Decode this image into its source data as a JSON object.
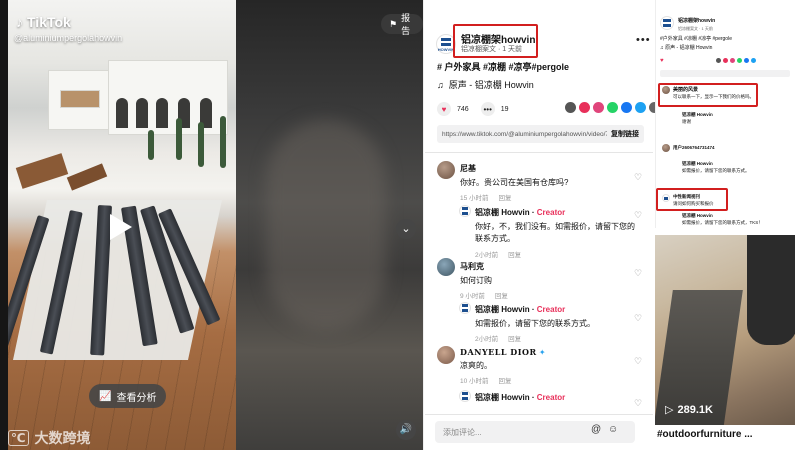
{
  "video": {
    "app_name": "TikTok",
    "handle": "@aluminiumpergolahowvin",
    "report_label": "报告",
    "analysis_label": "查看分析",
    "watermark": "大数跨境"
  },
  "post": {
    "author_name": "铝凉棚架howvin",
    "author_subtitle": "铝凉棚案文 · 1 天前",
    "hashtags": "# 户外家具 #凉棚 #凉亭#pergole",
    "sound": "原声 - 铝凉棚 Howvin",
    "likes": "746",
    "comments": "19",
    "url": "https://www.tiktok.com/@aluminiumpergolahowvin/video/71...",
    "copy_link": "复制链接"
  },
  "comments": [
    {
      "name": "尼基",
      "text": "你好。贵公司在美国有仓库吗?",
      "time": "15 小时前",
      "reply": "回复"
    },
    {
      "name": "铝凉棚 Howvin · ",
      "creator": "Creator",
      "text": "你好，不，我们没有。如需报价，请留下您的联系方式。",
      "time": "2小时前",
      "reply": "回复"
    },
    {
      "name": "马利克",
      "text": "如何订购",
      "time": "9 小时前",
      "reply": "回复"
    },
    {
      "name": "铝凉棚 Howvin · ",
      "creator": "Creator",
      "text": "如需报价，请留下您的联系方式。",
      "time": "2小时前",
      "reply": "回复"
    },
    {
      "name": "DANYELL DIOR",
      "text": "凉爽的。",
      "time": "10 小时前",
      "reply": "回复"
    },
    {
      "name": "铝凉棚 Howvin · ",
      "creator": "Creator",
      "text": "",
      "time": "",
      "reply": ""
    }
  ],
  "add_comment_placeholder": "添加评论...",
  "right": {
    "author": "铝凉棚架howvin",
    "sub": "铝凉棚案文 · 1 天前",
    "hashtags": "#户外家具 #凉棚 #凉亭 #pergole",
    "sound": "♫ 原声 - 铝凉棚 Howvin",
    "c1_name": "美丽的风景",
    "c1_text": "可以联系一下，显示一下我们的价格吗。",
    "c2_name": "铝凉棚 Howvin",
    "c2_text": "谢谢",
    "c3_name": "用户2606764731474",
    "c4_name": "铝凉棚 Howvin",
    "c4_text": "如需报价，请留下您的联系方式。",
    "c5_name": "中性新闻视刊",
    "c5_text": "请问如何购买和报价",
    "c6_name": "铝凉棚 Howvin",
    "c6_text": "如需报价，请留下您的联系方式，TKS！",
    "views": "289.1K",
    "title": "#outdoorfurniture ..."
  }
}
